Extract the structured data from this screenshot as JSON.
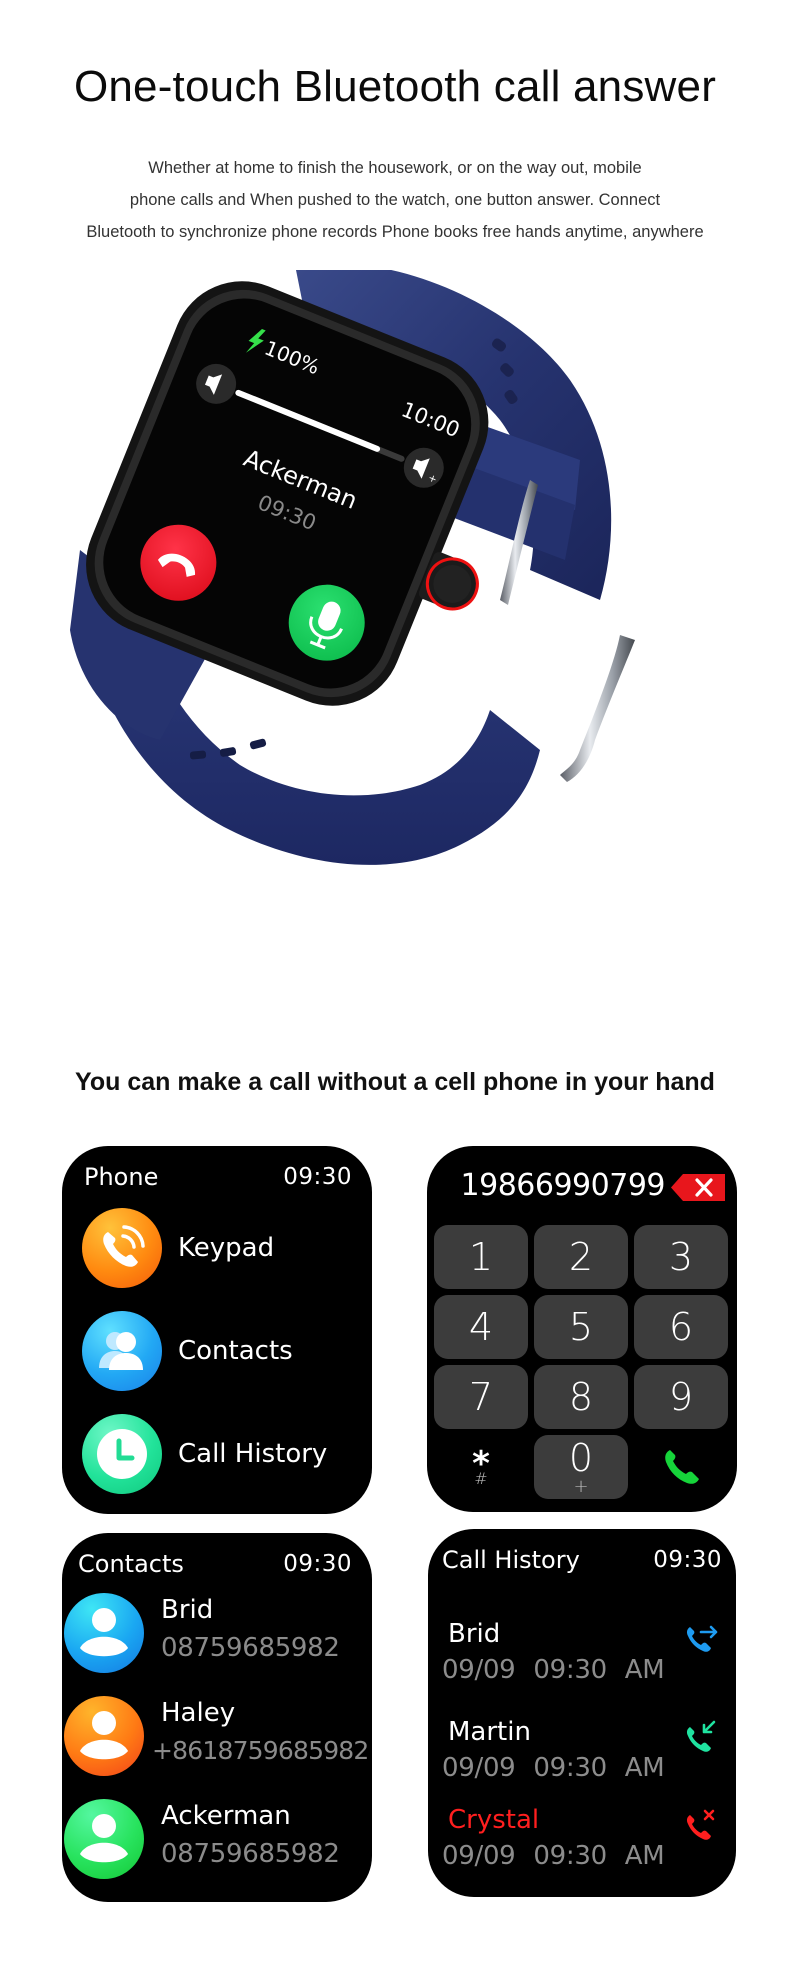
{
  "hero": {
    "title": "One-touch Bluetooth call answer",
    "description": [
      "Whether at home to finish the housework, or on the way out, mobile",
      "phone calls and When pushed to the watch, one button answer. Connect",
      "Bluetooth to synchronize phone records Phone books free hands anytime, anywhere"
    ]
  },
  "watch_screen": {
    "battery": "100%",
    "clock": "10:00",
    "caller_name": "Ackerman",
    "call_time": "09:30",
    "volume_level": 0.85,
    "band_color": "#23306b",
    "decline_color": "#f0192e",
    "answer_color": "#14c95a"
  },
  "section": {
    "title": "You can make a call without a cell phone in your hand"
  },
  "phone_menu": {
    "title": "Phone",
    "time": "09:30",
    "items": [
      {
        "label": "Keypad",
        "icon": "phone-ringing-icon"
      },
      {
        "label": "Contacts",
        "icon": "contacts-icon"
      },
      {
        "label": "Call History",
        "icon": "clock-icon"
      }
    ]
  },
  "dialpad": {
    "number": "19866990799",
    "delete_icon": "backspace-icon",
    "keys": [
      "1",
      "2",
      "3",
      "4",
      "5",
      "6",
      "7",
      "8",
      "9"
    ],
    "star_key": {
      "main": "*",
      "sub": "#"
    },
    "zero_key": {
      "main": "0",
      "sub": "+"
    },
    "call_icon": "call-icon"
  },
  "contacts": {
    "title": "Contacts",
    "time": "09:30",
    "list": [
      {
        "name": "Brid",
        "phone": "08759685982"
      },
      {
        "name": "Haley",
        "phone": "+8618759685982"
      },
      {
        "name": "Ackerman",
        "phone": "08759685982"
      }
    ]
  },
  "call_history": {
    "title": "Call History",
    "time": "09:30",
    "list": [
      {
        "name": "Brid",
        "datetime": "09/09 09:30 AM",
        "type": "outgoing",
        "color": "#1e9bf0"
      },
      {
        "name": "Martin",
        "datetime": "09/09 09:30 AM",
        "type": "incoming",
        "color": "#1fe3a0"
      },
      {
        "name": "Crystal",
        "datetime": "09/09 09:30 AM",
        "type": "missed",
        "color": "#ff1f1f"
      }
    ]
  }
}
